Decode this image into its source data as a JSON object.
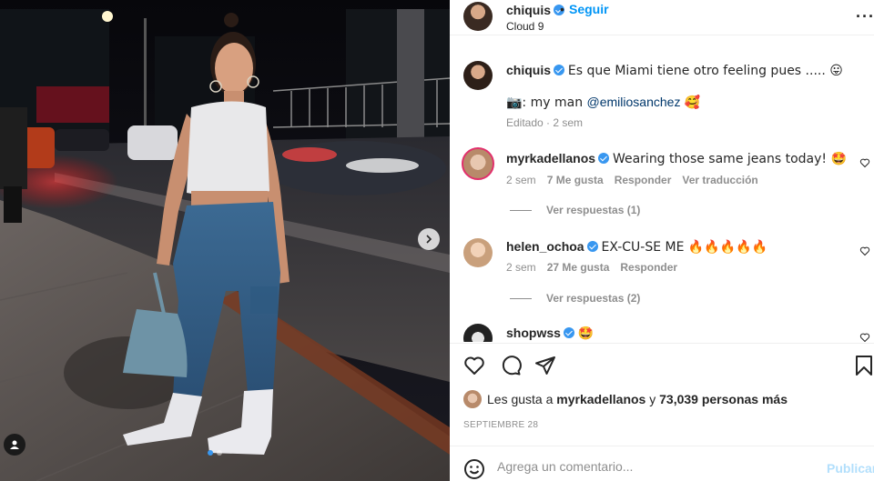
{
  "header": {
    "username": "chiquis",
    "separator": "•",
    "follow_label": "Seguir",
    "location": "Cloud 9",
    "more_label": "···"
  },
  "caption": {
    "username": "chiquis",
    "text": "Es que Miami tiene otro feeling pues ..... 😛",
    "credit_prefix": "📷: my man ",
    "mention": "@emiliosanchez",
    "credit_suffix": " 🥰",
    "meta": "Editado · 2 sem"
  },
  "comments": [
    {
      "username": "myrkadellanos",
      "text": "Wearing those same jeans today! 🤩",
      "time": "2 sem",
      "likes": "7 Me gusta",
      "reply": "Responder",
      "translate": "Ver traducción",
      "view_replies": "Ver respuestas (1)"
    },
    {
      "username": "helen_ochoa",
      "text": "EX-CU-SE ME 🔥🔥🔥🔥🔥",
      "time": "2 sem",
      "likes": "27 Me gusta",
      "reply": "Responder",
      "view_replies": "Ver respuestas (2)"
    },
    {
      "username": "shopwss",
      "text": "🤩"
    }
  ],
  "likes": {
    "prefix": "Les gusta a ",
    "user": "myrkadellanos",
    "middle": " y ",
    "count": "73,039 personas más"
  },
  "date": "SEPTIEMBRE 28",
  "comment_box": {
    "placeholder": "Agrega un comentario...",
    "post_label": "Publicar"
  },
  "colors": {
    "accent": "#0095f6",
    "verified": "#3897f0",
    "muted": "#8e8e8e"
  }
}
